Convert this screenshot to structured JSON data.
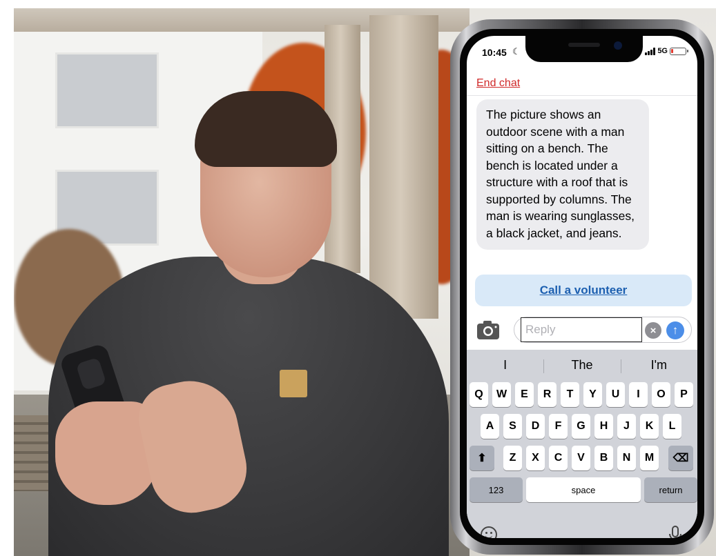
{
  "status_bar": {
    "time": "10:45",
    "network": "5G",
    "battery_level": 0.15,
    "battery_color": "#e5392f"
  },
  "chat": {
    "end_chat_label": "End chat",
    "message": "The picture shows an outdoor scene with a man sitting on a bench. The bench is located under a structure with a roof that is supported by columns. The man is wearing sunglasses, a black jacket, and jeans.",
    "call_volunteer_label": "Call a volunteer"
  },
  "composer": {
    "placeholder": "Reply",
    "value": ""
  },
  "keyboard": {
    "suggestions": [
      "I",
      "The",
      "I'm"
    ],
    "row1": [
      "Q",
      "W",
      "E",
      "R",
      "T",
      "Y",
      "U",
      "I",
      "O",
      "P"
    ],
    "row2": [
      "A",
      "S",
      "D",
      "F",
      "G",
      "H",
      "J",
      "K",
      "L"
    ],
    "row3": [
      "Z",
      "X",
      "C",
      "V",
      "B",
      "N",
      "M"
    ],
    "numbers_label": "123",
    "space_label": "space",
    "return_label": "return"
  },
  "icons": {
    "moon": "moon-icon",
    "camera": "camera-icon",
    "clear": "clear-icon",
    "send": "send-arrow-icon",
    "shift": "shift-icon",
    "backspace": "backspace-icon",
    "emoji": "emoji-icon",
    "mic": "microphone-icon"
  },
  "colors": {
    "end_chat": "#d02a2a",
    "volunteer_button_bg": "#d9e9f8",
    "volunteer_text": "#1c5fb0",
    "send_button": "#4c8ee8",
    "keyboard_bg": "#d1d3d9"
  }
}
